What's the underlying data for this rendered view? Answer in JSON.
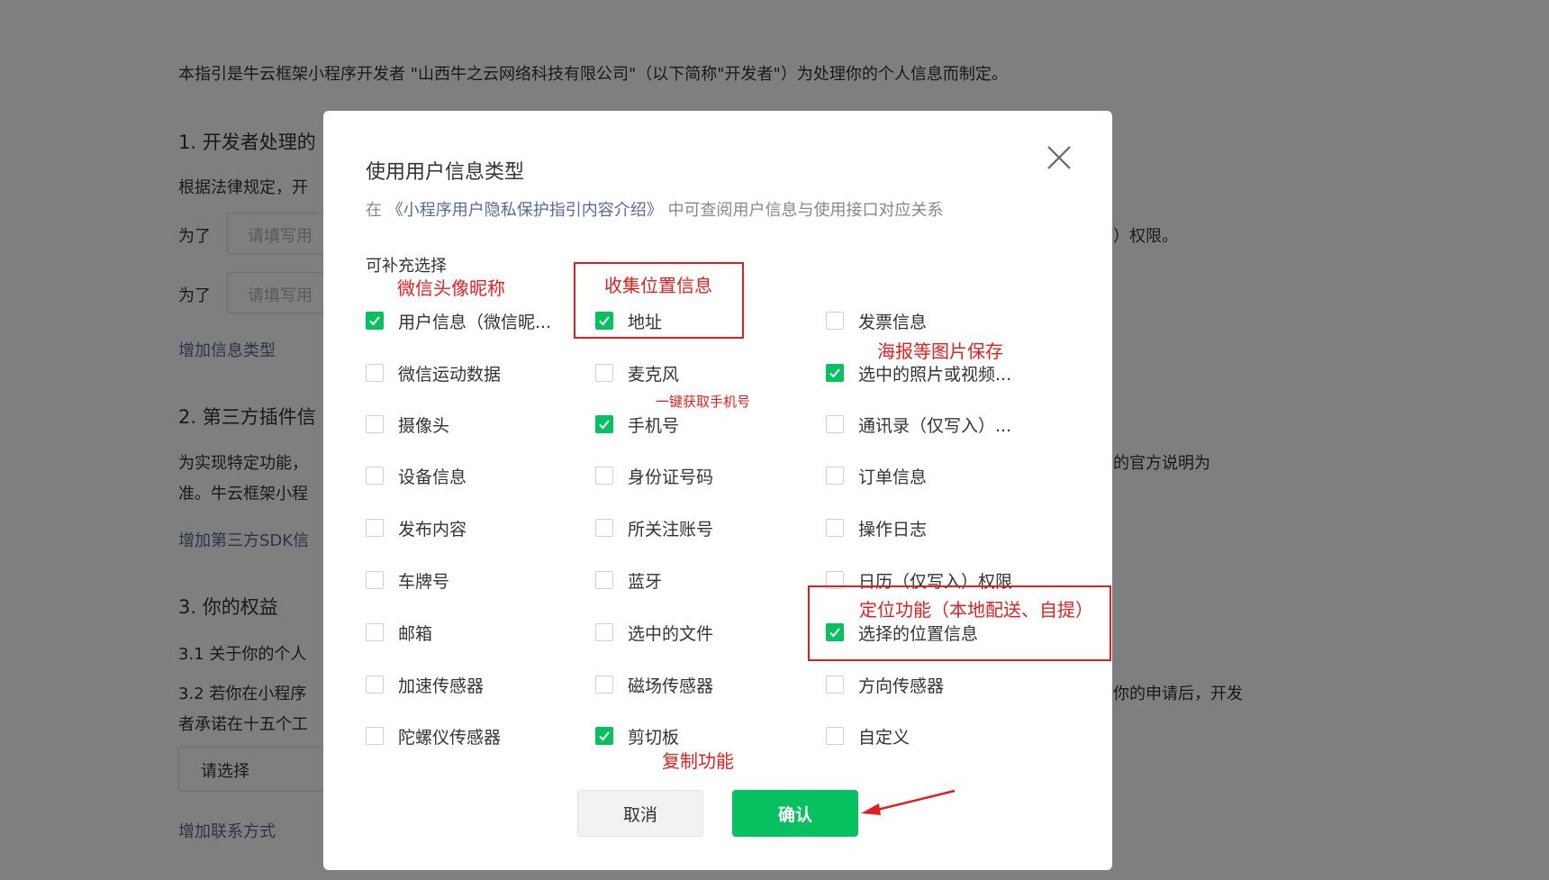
{
  "background": {
    "intro": "本指引是牛云框架小程序开发者 \"山西牛之云网络科技有限公司\"（以下简称\"开发者\"）为处理你的个人信息而制定。",
    "section1_title": "1. 开发者处理的",
    "section1_text": "根据法律规定，开",
    "for_label": "为了",
    "input_placeholder": "请填写用",
    "permission_suffix": "）权限。",
    "add_info_type": "增加信息类型",
    "section2_title": "2. 第三方插件信",
    "section2_text_right": "的官方说明为",
    "section2_text_a": "为实现特定功能，",
    "section2_text_b": "准。牛云框架小程",
    "add_sdk": "增加第三方SDK信",
    "section3_title": "3. 你的权益",
    "s31": "3.1  关于你的个人",
    "s32": "3.2  若你在小程序",
    "s32_right": "你的申请后，开发",
    "s32_b": "者承诺在十五个工",
    "select_placeholder": "请选择",
    "add_contact": "增加联系方式"
  },
  "dialog": {
    "title": "使用用户信息类型",
    "desc_prefix": "在",
    "desc_link": "《小程序用户隐私保护指引内容介绍》",
    "desc_suffix": "中可查阅用户信息与使用接口对应关系",
    "section_label": "可补充选择",
    "options": [
      {
        "label": "用户信息（微信昵...",
        "checked": true
      },
      {
        "label": "地址",
        "checked": true
      },
      {
        "label": "发票信息",
        "checked": false
      },
      {
        "label": "微信运动数据",
        "checked": false
      },
      {
        "label": "麦克风",
        "checked": false
      },
      {
        "label": "选中的照片或视频...",
        "checked": true
      },
      {
        "label": "摄像头",
        "checked": false
      },
      {
        "label": "手机号",
        "checked": true
      },
      {
        "label": "通讯录（仅写入）...",
        "checked": false
      },
      {
        "label": "设备信息",
        "checked": false
      },
      {
        "label": "身份证号码",
        "checked": false
      },
      {
        "label": "订单信息",
        "checked": false
      },
      {
        "label": "发布内容",
        "checked": false
      },
      {
        "label": "所关注账号",
        "checked": false
      },
      {
        "label": "操作日志",
        "checked": false
      },
      {
        "label": "车牌号",
        "checked": false
      },
      {
        "label": "蓝牙",
        "checked": false
      },
      {
        "label": "日历（仅写入）权限",
        "checked": false
      },
      {
        "label": "邮箱",
        "checked": false
      },
      {
        "label": "选中的文件",
        "checked": false
      },
      {
        "label": "选择的位置信息",
        "checked": true
      },
      {
        "label": "加速传感器",
        "checked": false
      },
      {
        "label": "磁场传感器",
        "checked": false
      },
      {
        "label": "方向传感器",
        "checked": false
      },
      {
        "label": "陀螺仪传感器",
        "checked": false
      },
      {
        "label": "剪切板",
        "checked": true
      },
      {
        "label": "自定义",
        "checked": false
      }
    ],
    "cancel_label": "取消",
    "confirm_label": "确认"
  },
  "annotations": {
    "wechat_avatar": "微信头像昵称",
    "collect_location": "收集位置信息",
    "poster_save": "海报等图片保存",
    "get_phone": "一键获取手机号",
    "location_feature": "定位功能（本地配送、自提）",
    "copy_feature": "复制功能"
  },
  "colors": {
    "accent_green": "#07c160",
    "annotation_red": "#e02020",
    "link_blue": "#576b95"
  }
}
